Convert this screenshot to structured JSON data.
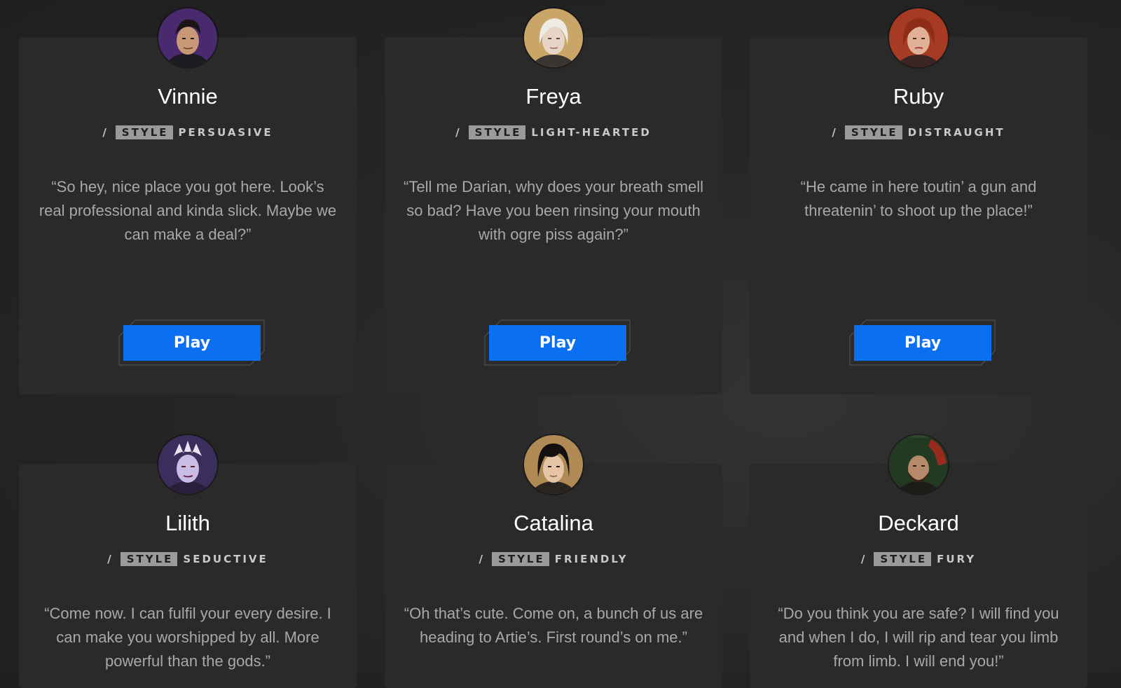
{
  "style_label": "STYLE",
  "style_separator": "/",
  "play_label": "Play",
  "accent_color": "#0a6ff0",
  "characters": [
    {
      "name": "Vinnie",
      "style": "PERSUASIVE",
      "quote": "“So hey, nice place you got here. Look’s real professional and kinda slick. Maybe we can make a deal?”"
    },
    {
      "name": "Freya",
      "style": "LIGHT-HEARTED",
      "quote": "“Tell me Darian, why does your breath smell so bad? Have you been rinsing your mouth with ogre piss again?”"
    },
    {
      "name": "Ruby",
      "style": "DISTRAUGHT",
      "quote": "“He came in here toutin’ a gun and threatenin’ to shoot up the place!”"
    },
    {
      "name": "Lilith",
      "style": "SEDUCTIVE",
      "quote": "“Come now. I can fulfil your every desire. I can make you worshipped by all. More powerful than the gods.”"
    },
    {
      "name": "Catalina",
      "style": "FRIENDLY",
      "quote": "“Oh that’s cute. Come on, a bunch of us are heading to Artie’s. First round’s on me.”"
    },
    {
      "name": "Deckard",
      "style": "FURY",
      "quote": "“Do you think you are safe? I will find you and when I do, I will rip and tear you limb from limb. I will end you!”"
    }
  ]
}
